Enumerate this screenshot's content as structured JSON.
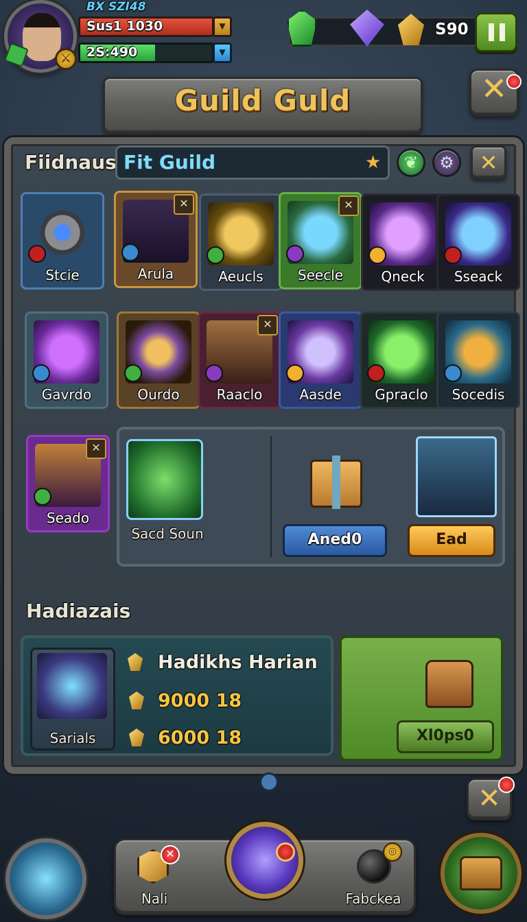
{
  "player": {
    "id_text": "BX SZI48",
    "hp_label": "Sus1 1030",
    "xp_label": "2S:490",
    "xp_fraction": 0.57
  },
  "currency": {
    "coins": "S90"
  },
  "title": {
    "text": "Guild Guld",
    "close_label": "✕"
  },
  "filter": {
    "section_label": "Fiidnaus",
    "search_value": "Fit Guild",
    "close_label": "✕"
  },
  "cards": [
    {
      "name": "Stcie",
      "frame": "#4f7fb0",
      "bg": "#2a4a6a",
      "art": "radial-gradient(circle,#4a8aff 0 18%,#8a8c90 19% 38%,#3a3c40 39% 48%,transparent 49%)",
      "corner": ""
    },
    {
      "name": "Arula",
      "frame": "#c9963f",
      "bg": "#6a4a2a",
      "art": "linear-gradient(180deg,#3a2a50,#1a1028)",
      "corner": "✕"
    },
    {
      "name": "Aeucls",
      "frame": "#4f5f70",
      "bg": "#2e3a46",
      "art": "radial-gradient(circle,#f0c860 0 35%,#6a5010 60%,#2a2008)",
      "corner": ""
    },
    {
      "name": "Seecle",
      "frame": "#6ab04a",
      "bg": "#3a7a2a",
      "art": "radial-gradient(circle,#7ad8ff 0 35%,#2a6a40 65%,#143a1a)",
      "corner": "✕"
    },
    {
      "name": "Qneck",
      "frame": "#2a2a34",
      "bg": "#1c1c24",
      "art": "radial-gradient(circle,#e0a0ff 0 35%,#5a2a8a 65%,#1e0e30)",
      "corner": ""
    },
    {
      "name": "Sseack",
      "frame": "#2a2a34",
      "bg": "#1c1c24",
      "art": "radial-gradient(circle,#80d0ff 0 35%,#3a2a8a 65%,#14102e)",
      "corner": ""
    },
    {
      "name": "Gavrdo",
      "frame": "#4f6f80",
      "bg": "#3a5260",
      "art": "radial-gradient(circle,#d070ff 0 35%,#6a2a9a 65%,#2a1040)",
      "corner": ""
    },
    {
      "name": "Ourdo",
      "frame": "#a07a3a",
      "bg": "#5a4226",
      "art": "radial-gradient(circle,#f0c060 0 25%,#7a4aa0 45%,#2a1a0a 75%)",
      "corner": ""
    },
    {
      "name": "Raaclo",
      "frame": "#6a2a40",
      "bg": "#4a2030",
      "art": "linear-gradient(180deg,#a07040,#3a2018)",
      "corner": "✕"
    },
    {
      "name": "Aasde",
      "frame": "#3a5aa0",
      "bg": "#2a3a70",
      "art": "radial-gradient(circle,#d0c0ff 0 30%,#6a3aa0 60%,#1a1040)",
      "corner": ""
    },
    {
      "name": "Gpraclo",
      "frame": "#2a3a3a",
      "bg": "#1e2a2a",
      "art": "radial-gradient(circle,#8af06a 0 35%,#1e6a2a 65%,#0a2a10)",
      "corner": ""
    },
    {
      "name": "Socedis",
      "frame": "#2a3a44",
      "bg": "#1e2a34",
      "art": "radial-gradient(circle,#f0b040 0 30%,#2a6a8a 60%,#0e2a3a)",
      "corner": ""
    },
    {
      "name": "Seado",
      "frame": "#9a3ac0",
      "bg": "#6a2a90",
      "art": "linear-gradient(180deg,#c0803a,#3a1a40)",
      "corner": "✕"
    }
  ],
  "featured": {
    "item_name": "Sacd Soun",
    "claim_label": "Aned0",
    "end_label": "Ead"
  },
  "rewards": {
    "heading": "Hadiazais",
    "card_name": "Sarials",
    "title": "Hadikhs Harian",
    "line_1": "9000 18",
    "line_2": "6000 18",
    "collect_label": "Xl0ps0"
  },
  "nav": {
    "left_label": "Nali",
    "left_badge": "✕",
    "right_label": "Fabckea",
    "notice_close_label": "✕"
  }
}
